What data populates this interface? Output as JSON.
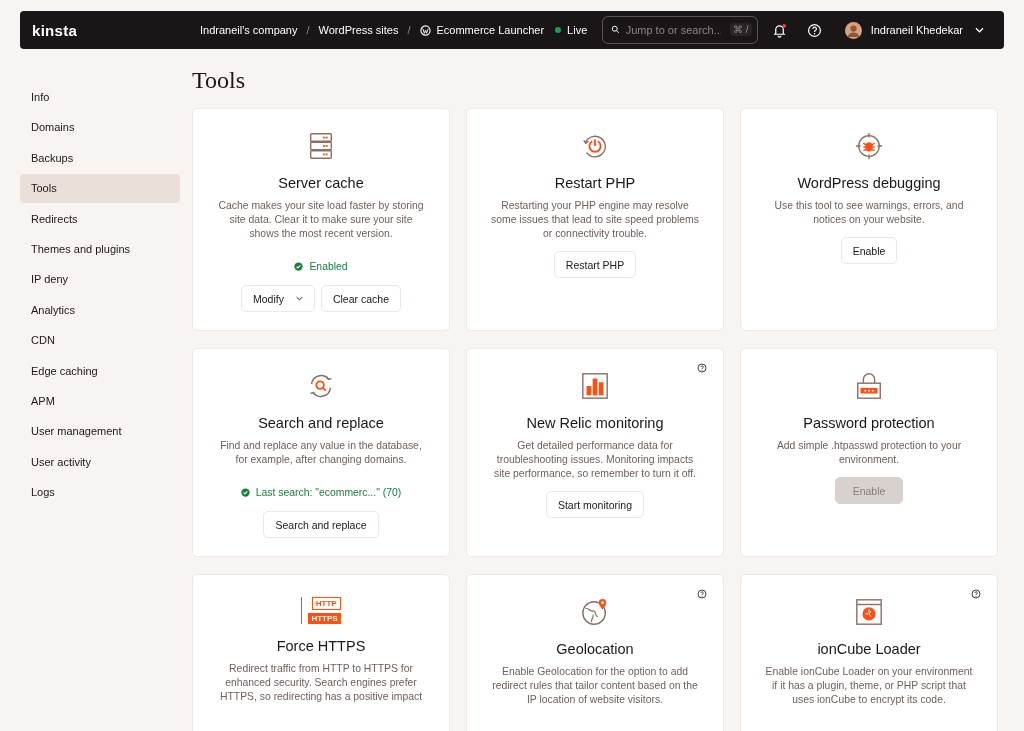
{
  "topbar": {
    "logo": "kinsta",
    "separator": "/",
    "breadcrumbs": [
      {
        "label": "Indraneil's company",
        "kind": "text"
      },
      {
        "label": "WordPress sites",
        "kind": "text"
      },
      {
        "label": "Ecommerce Launcher",
        "kind": "site"
      }
    ],
    "site_status": {
      "label": "Live",
      "color": "#1f9d55"
    },
    "search": {
      "placeholder": "Jump to or search...",
      "shortcut": "⌘ /"
    },
    "notifications": {
      "unread": true
    },
    "user": {
      "name": "Indraneil Khedekar"
    }
  },
  "sidebar": {
    "items": [
      {
        "label": "Info",
        "selected": false
      },
      {
        "label": "Domains",
        "selected": false
      },
      {
        "label": "Backups",
        "selected": false
      },
      {
        "label": "Tools",
        "selected": true
      },
      {
        "label": "Redirects",
        "selected": false
      },
      {
        "label": "Themes and plugins",
        "selected": false
      },
      {
        "label": "IP deny",
        "selected": false
      },
      {
        "label": "Analytics",
        "selected": false
      },
      {
        "label": "CDN",
        "selected": false
      },
      {
        "label": "Edge caching",
        "selected": false
      },
      {
        "label": "APM",
        "selected": false
      },
      {
        "label": "User management",
        "selected": false
      },
      {
        "label": "User activity",
        "selected": false
      },
      {
        "label": "Logs",
        "selected": false
      }
    ]
  },
  "page_title": "Tools",
  "cards": [
    {
      "title": "Server cache",
      "description": "Cache makes your site load faster by storing site data. Clear it to make sure your site shows the most recent version.",
      "help": false,
      "status": "Enabled",
      "buttons": [
        {
          "label": "Modify",
          "kind": "dropdown",
          "disabled": false
        },
        {
          "label": "Clear cache",
          "kind": "plain",
          "disabled": false
        }
      ]
    },
    {
      "title": "Restart PHP",
      "description": "Restarting your PHP engine may resolve some issues that lead to site speed problems or connectivity trouble.",
      "help": false,
      "buttons": [
        {
          "label": "Restart PHP",
          "kind": "plain",
          "disabled": false
        }
      ]
    },
    {
      "title": "WordPress debugging",
      "description": "Use this tool to see warnings, errors, and notices on your website.",
      "help": false,
      "buttons": [
        {
          "label": "Enable",
          "kind": "plain",
          "disabled": false
        }
      ]
    },
    {
      "title": "Search and replace",
      "description": "Find and replace any value in the database, for example, after changing domains.",
      "help": false,
      "status": "Last search: \"ecommerc...\" (70)",
      "buttons": [
        {
          "label": "Search and replace",
          "kind": "plain",
          "disabled": false
        }
      ]
    },
    {
      "title": "New Relic monitoring",
      "description": "Get detailed performance data for troubleshooting issues. Monitoring impacts site performance, so remember to turn it off.",
      "help": true,
      "buttons": [
        {
          "label": "Start monitoring",
          "kind": "plain",
          "disabled": false
        }
      ]
    },
    {
      "title": "Password protection",
      "description": "Add simple .htpasswd protection to your environment.",
      "help": false,
      "buttons": [
        {
          "label": "Enable",
          "kind": "plain",
          "disabled": true
        }
      ]
    },
    {
      "icon_labels": [
        "HTTP",
        "HTTPS"
      ],
      "title": "Force HTTPS",
      "description": "Redirect traffic from HTTP to HTTPS for enhanced security. Search engines prefer HTTPS, so redirecting has a positive impact",
      "help": false
    },
    {
      "title": "Geolocation",
      "description": "Enable Geolocation for the option to add redirect rules that tailor content based on the IP location of website visitors.",
      "help": true
    },
    {
      "title": "ionCube Loader",
      "description": "Enable ionCube Loader on your environment if it has a plugin, theme, or PHP script that uses ionCube to encrypt its code.",
      "help": true
    }
  ]
}
